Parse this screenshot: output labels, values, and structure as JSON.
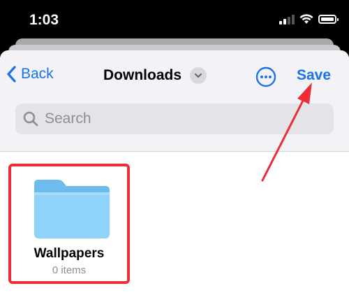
{
  "status_bar": {
    "time": "1:03"
  },
  "header": {
    "back_label": "Back",
    "title": "Downloads",
    "save_label": "Save"
  },
  "search": {
    "placeholder": "Search"
  },
  "folders": [
    {
      "name": "Wallpapers",
      "count": "0 items"
    }
  ],
  "colors": {
    "accent": "#1a73e8",
    "annotation": "#ec2d38",
    "folder_blue": "#7cc7f5"
  },
  "icons": [
    "chevron-left-icon",
    "chevron-down-icon",
    "more-icon",
    "search-icon",
    "folder-icon",
    "wifi-icon",
    "signal-icon",
    "battery-icon"
  ]
}
